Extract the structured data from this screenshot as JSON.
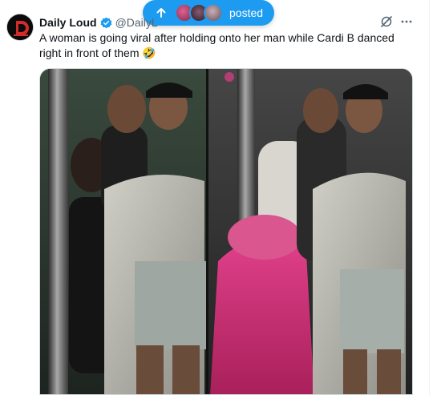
{
  "notification": {
    "label": "posted",
    "up_icon": "arrow-up-icon",
    "avatar_colors": [
      "#c94a7a",
      "#5a3a52",
      "#9a7c86"
    ]
  },
  "tweet": {
    "author_name": "Daily Loud",
    "handle": "@DailyL",
    "verified": true,
    "avatar_text": "D",
    "text": "A woman is going viral after holding onto her man while Cardi B danced right in front of them 🤣"
  },
  "colors": {
    "accent": "#1d9bf0",
    "text_primary": "#0f1419",
    "text_secondary": "#536471",
    "border": "#cfd9de",
    "cardi_dress": "#d0307a"
  },
  "icons": {
    "grok": "grok-icon",
    "more": "more-horizontal-icon",
    "verified": "verified-badge-icon"
  }
}
